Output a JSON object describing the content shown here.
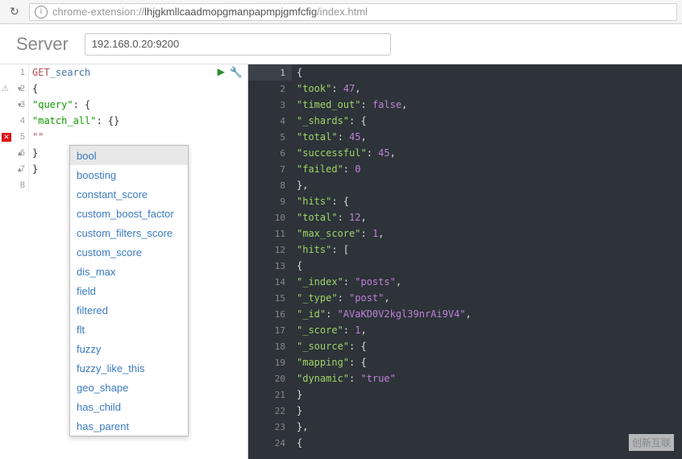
{
  "browser": {
    "reload_glyph": "↻",
    "info_glyph": "i",
    "url_prefix": "chrome-extension://",
    "url_host": "lhjgkmllcaadmopgmanpapmpjgmfcfig",
    "url_path": "/index.html"
  },
  "server": {
    "label": "Server",
    "value": "192.168.0.20:9200"
  },
  "left_editor": {
    "lines": [
      {
        "num": "1",
        "type": "req",
        "method": "GET",
        "path": "_search"
      },
      {
        "num": "2",
        "type": "punc",
        "text": "{",
        "warn": true,
        "fold": "▾"
      },
      {
        "num": "3",
        "type": "kv",
        "indent": "  ",
        "key": "\"query\"",
        "after": ": {",
        "fold": "▾"
      },
      {
        "num": "4",
        "type": "kv",
        "indent": "     ",
        "key": "\"match_all\"",
        "after": ": {}"
      },
      {
        "num": "5",
        "type": "str",
        "indent": "     ",
        "text": "\"\"",
        "err": true
      },
      {
        "num": "6",
        "type": "punc",
        "indent": "  ",
        "text": "}",
        "fold": "▴"
      },
      {
        "num": "7",
        "type": "punc",
        "text": "}",
        "fold": "▴"
      },
      {
        "num": "8",
        "type": "blank"
      }
    ],
    "run_glyph": "▶",
    "tool_glyph": "🔧"
  },
  "autocomplete": {
    "items": [
      "bool",
      "boosting",
      "constant_score",
      "custom_boost_factor",
      "custom_filters_score",
      "custom_score",
      "dis_max",
      "field",
      "filtered",
      "flt",
      "fuzzy",
      "fuzzy_like_this",
      "geo_shape",
      "has_child",
      "has_parent"
    ]
  },
  "right_editor": {
    "lines": [
      {
        "n": 1,
        "t": "punc",
        "txt": "{",
        "fold": "▾"
      },
      {
        "n": 2,
        "t": "kv",
        "ind": "   ",
        "k": "\"took\"",
        "v": "47",
        "vt": "num",
        "c": ","
      },
      {
        "n": 3,
        "t": "kv",
        "ind": "   ",
        "k": "\"timed_out\"",
        "v": "false",
        "vt": "bool",
        "c": ","
      },
      {
        "n": 4,
        "t": "kobj",
        "ind": "   ",
        "k": "\"_shards\"",
        "fold": "▾"
      },
      {
        "n": 5,
        "t": "kv",
        "ind": "      ",
        "k": "\"total\"",
        "v": "45",
        "vt": "num",
        "c": ","
      },
      {
        "n": 6,
        "t": "kv",
        "ind": "      ",
        "k": "\"successful\"",
        "v": "45",
        "vt": "num",
        "c": ","
      },
      {
        "n": 7,
        "t": "kv",
        "ind": "      ",
        "k": "\"failed\"",
        "v": "0",
        "vt": "num"
      },
      {
        "n": 8,
        "t": "close",
        "ind": "   ",
        "txt": "},"
      },
      {
        "n": 9,
        "t": "kobj",
        "ind": "   ",
        "k": "\"hits\"",
        "fold": "▾"
      },
      {
        "n": 10,
        "t": "kv",
        "ind": "      ",
        "k": "\"total\"",
        "v": "12",
        "vt": "num",
        "c": ","
      },
      {
        "n": 11,
        "t": "kv",
        "ind": "      ",
        "k": "\"max_score\"",
        "v": "1",
        "vt": "num",
        "c": ","
      },
      {
        "n": 12,
        "t": "karr",
        "ind": "      ",
        "k": "\"hits\"",
        "fold": "▾"
      },
      {
        "n": 13,
        "t": "punc",
        "ind": "         ",
        "txt": "{",
        "fold": "▾"
      },
      {
        "n": 14,
        "t": "kv",
        "ind": "            ",
        "k": "\"_index\"",
        "v": "\"posts\"",
        "vt": "str",
        "c": ","
      },
      {
        "n": 15,
        "t": "kv",
        "ind": "            ",
        "k": "\"_type\"",
        "v": "\"post\"",
        "vt": "str",
        "c": ","
      },
      {
        "n": 16,
        "t": "kv",
        "ind": "            ",
        "k": "\"_id\"",
        "v": "\"AVaKD0V2kgl39nrAi9V4\"",
        "vt": "str",
        "c": ","
      },
      {
        "n": 17,
        "t": "kv",
        "ind": "            ",
        "k": "\"_score\"",
        "v": "1",
        "vt": "num",
        "c": ","
      },
      {
        "n": 18,
        "t": "kobj",
        "ind": "            ",
        "k": "\"_source\"",
        "fold": "▾"
      },
      {
        "n": 19,
        "t": "kobj",
        "ind": "               ",
        "k": "\"mapping\"",
        "fold": "▾"
      },
      {
        "n": 20,
        "t": "kv",
        "ind": "                  ",
        "k": "\"dynamic\"",
        "v": "\"true\"",
        "vt": "str"
      },
      {
        "n": 21,
        "t": "close",
        "ind": "               ",
        "txt": "}"
      },
      {
        "n": 22,
        "t": "close",
        "ind": "            ",
        "txt": "}"
      },
      {
        "n": 23,
        "t": "close",
        "ind": "         ",
        "txt": "},"
      },
      {
        "n": 24,
        "t": "punc",
        "ind": "         ",
        "txt": "{",
        "fold": "▾"
      }
    ]
  },
  "watermark": {
    "text": "创新互联"
  }
}
